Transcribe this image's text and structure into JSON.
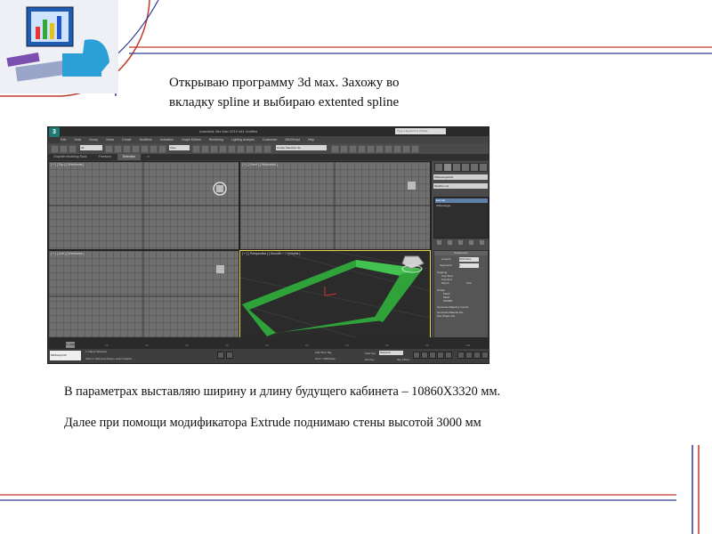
{
  "slide": {
    "heading_line1": "Открываю программу  3d мах. Захожу во",
    "heading_line2": "вкладку spline и выбираю extented spline",
    "body_line1": "В параметрах выставляю ширину и длину будущего кабинета – 10860Х3320 мм.",
    "body_line2": "Далее при помощи модификатора Extrude поднимаю стены высотой 3000 мм",
    "accent_color": "#c0392b",
    "accent_color_2": "#2c3e9a"
  },
  "app": {
    "logo_letter": "3",
    "title": "Autodesk 3ds Max 2010 x64        Untitled",
    "search_placeholder": "Type a keyword or phrase",
    "menus": [
      "Edit",
      "Tools",
      "Group",
      "Views",
      "Create",
      "Modifiers",
      "Animation",
      "Graph Editors",
      "Rendering",
      "Lighting Analysis",
      "Customize",
      "MAXScript",
      "Help"
    ],
    "toolbar": {
      "filter_dropdown": "All",
      "view_dropdown": "View",
      "selection_set": "Create Selection Se"
    },
    "ribbon_tabs": [
      "Graphite Modeling Tools",
      "Freeform",
      "Selection",
      "▪▪"
    ],
    "viewports": {
      "top": "[ + ] [ Top ] [ Wireframe ]",
      "front": "[ + ] [ Front ] [ Wireframe ]",
      "left": "[ + ] [ Left ] [ Wireframe ]",
      "perspective": "[ + ] [ Perspective ] [ Smooth + Highlights ]"
    },
    "command_panel": {
      "object_name": "WRectangle001",
      "modifier_list": "Modifier List",
      "stack_items": [
        "Extrude",
        "WRectangle"
      ],
      "rollout_title": "Parameters",
      "params": [
        {
          "label": "Amount:",
          "value": "3000,0мм"
        },
        {
          "label": "Segments:",
          "value": "1"
        }
      ],
      "capping_label": "Capping",
      "cap_start": "Cap Start",
      "cap_end": "Cap End",
      "morph": "Morph",
      "grid": "Grid",
      "output_label": "Output",
      "output_options": [
        "Patch",
        "Mesh",
        "NURBS"
      ],
      "mapping": "Generate Mapping Coords",
      "material_ids": "Generate Material IDs",
      "use_shape_ids": "Use Shape IDs"
    },
    "timeline": {
      "frame": "0 / 100",
      "ticks": [
        "0",
        "10",
        "20",
        "30",
        "40",
        "50",
        "60",
        "70",
        "80",
        "90",
        "100"
      ]
    },
    "status": {
      "maxscript": "MAXscript Mi",
      "selection": "1 Object Selected",
      "prompt": "Click or click-and-drag to select objects",
      "grid": "Grid = 1000,0мм",
      "add_time_tag": "Add Time Tag",
      "auto_key": "Auto Key",
      "selected": "Selected",
      "set_key": "Set Key",
      "key_filters": "Key Filters..."
    }
  }
}
